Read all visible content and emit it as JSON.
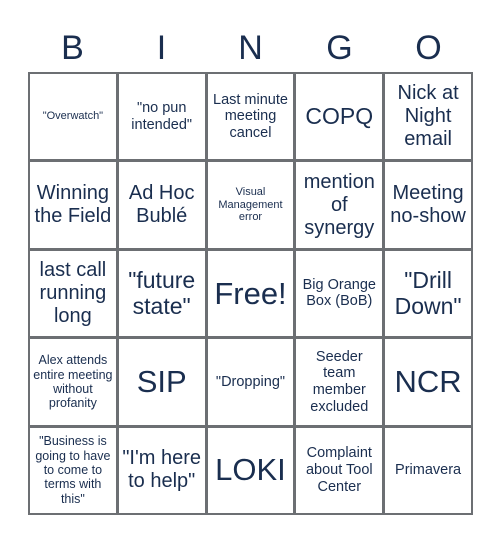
{
  "header": {
    "letters": [
      "B",
      "I",
      "N",
      "G",
      "O"
    ]
  },
  "colors": {
    "text": "#1a2e4f",
    "grid_line": "#6c6f73",
    "cell_background": "#ffffff"
  },
  "grid": {
    "rows": [
      [
        "\"Overwatch\"",
        "\"no pun intended\"",
        "Last minute meeting cancel",
        "COPQ",
        "Nick at Night email"
      ],
      [
        "Winning the Field",
        "Ad Hoc Bublé",
        "Visual Management error",
        "mention of synergy",
        "Meeting no-show"
      ],
      [
        "last call running long",
        "\"future state\"",
        "Free!",
        "Big Orange Box (BoB)",
        "\"Drill Down\""
      ],
      [
        "Alex attends entire meeting without profanity",
        "SIP",
        "\"Dropping\"",
        "Seeder team member excluded",
        "NCR"
      ],
      [
        "\"Business is going to have to come to terms with this\"",
        "\"I'm here to help\"",
        "LOKI",
        "Complaint about Tool Center",
        "Primavera"
      ]
    ],
    "free_space": "Free!"
  }
}
